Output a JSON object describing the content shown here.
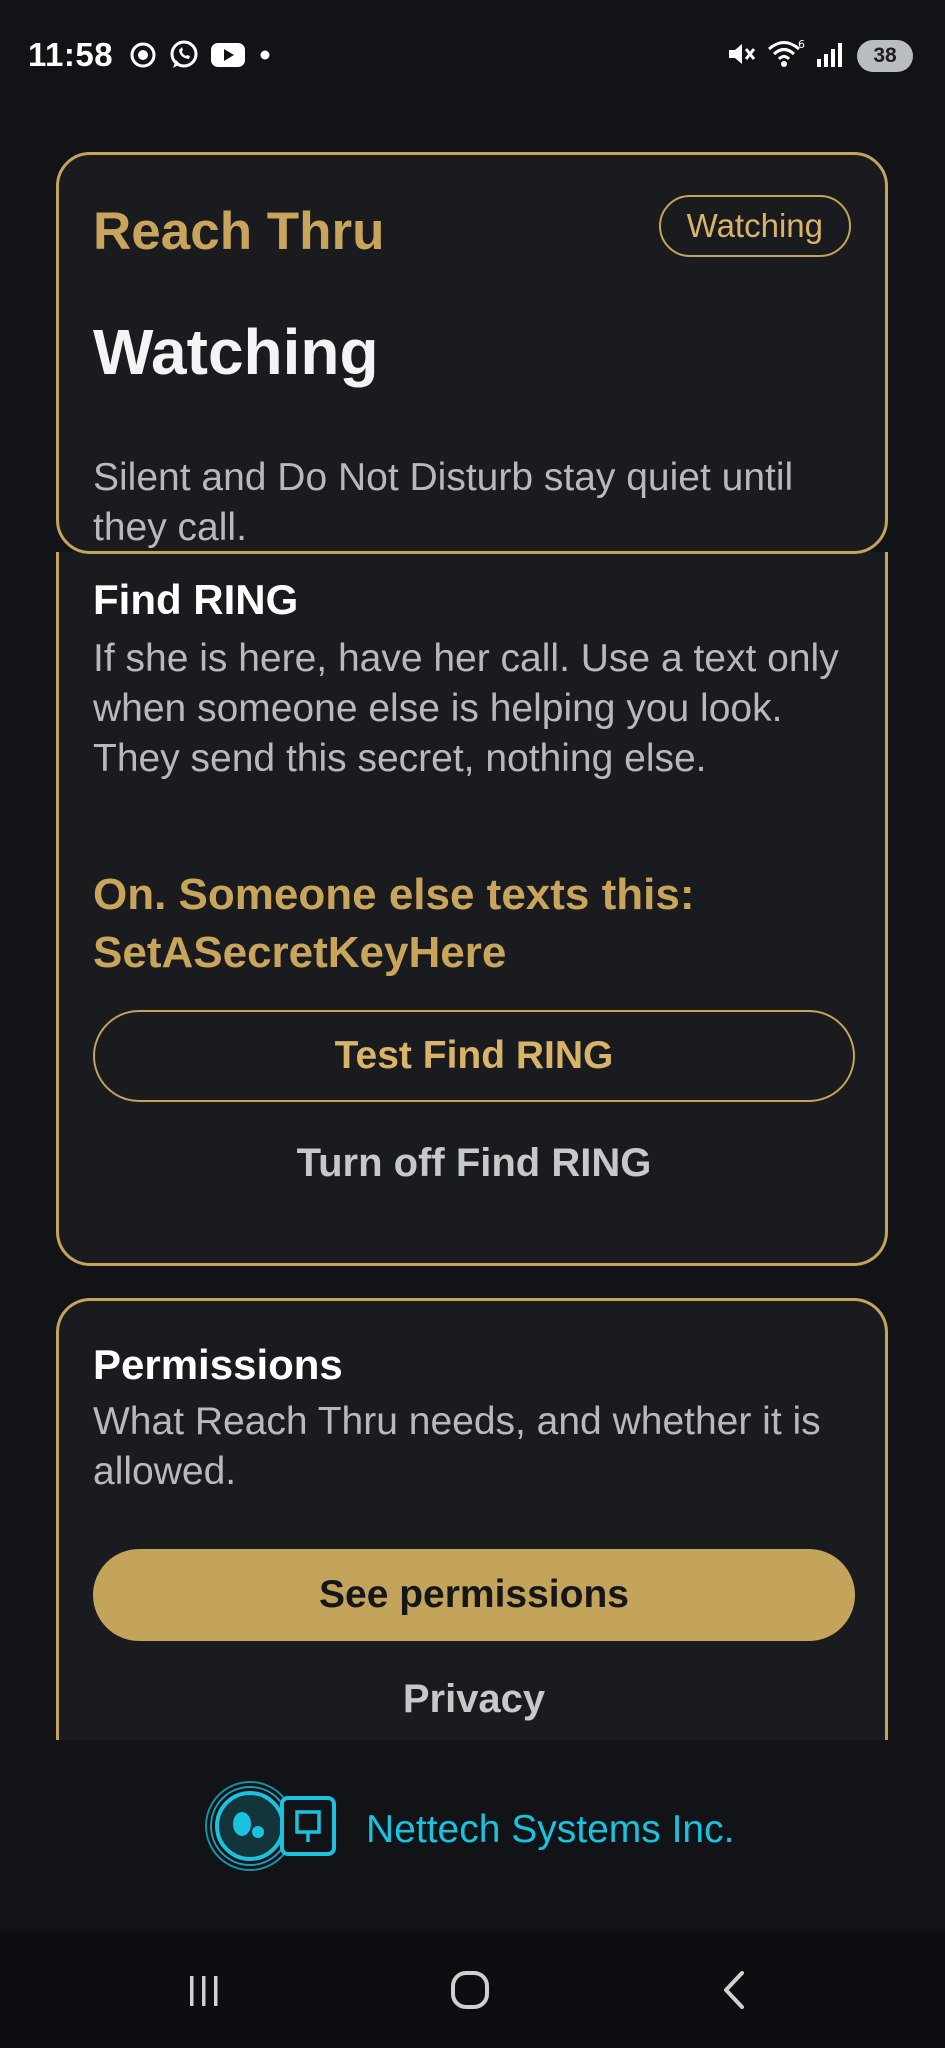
{
  "status_bar": {
    "time": "11:58",
    "battery": "38",
    "left_icons": [
      "record-icon",
      "whatsapp-icon",
      "youtube-icon",
      "dot-icon"
    ],
    "right_icons": [
      "mute-icon",
      "wifi-icon",
      "signal-icon"
    ]
  },
  "status_card": {
    "app_title": "Reach Thru",
    "chip_label": "Watching",
    "state_title": "Watching",
    "description": "Silent and Do Not Disturb stay quiet until they call."
  },
  "find_card": {
    "title": "Find RING",
    "description": "If she is here, have her call. Use a text only when someone else is helping you look. They send this secret, nothing else.",
    "status_line": "On. Someone else texts this: SetASecretKeyHere",
    "test_button": "Test Find RING",
    "turn_off_button": "Turn off Find RING"
  },
  "permissions_card": {
    "title": "Permissions",
    "description": "What Reach Thru needs, and whether it is allowed.",
    "see_button": "See permissions",
    "privacy_button": "Privacy"
  },
  "footer": {
    "company": "Nettech Systems Inc.",
    "brand_color": "#19c3e0"
  },
  "colors": {
    "accent": "#c4a35a",
    "background": "#111317",
    "card": "#1a1b1f"
  },
  "nav_bar": {
    "buttons": [
      "recents-icon",
      "home-icon",
      "back-icon"
    ]
  }
}
